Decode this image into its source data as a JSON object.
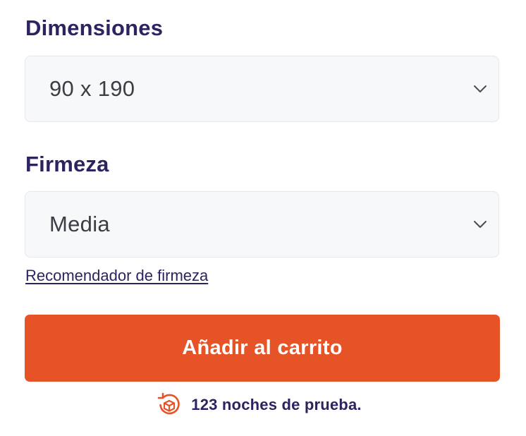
{
  "dimensions": {
    "label": "Dimensiones",
    "selected": "90 x 190",
    "icon": "chevron-down-icon"
  },
  "firmness": {
    "label": "Firmeza",
    "selected": "Media",
    "icon": "chevron-down-icon"
  },
  "firmness_recommender_link": "Recomendador de firmeza",
  "add_to_cart_label": "Añadir al carrito",
  "trial": {
    "icon": "trial-box-return-icon",
    "text": "123 noches de prueba."
  },
  "colors": {
    "accent": "#e65326",
    "heading": "#2b2461",
    "field_bg": "#f7f8fa"
  }
}
